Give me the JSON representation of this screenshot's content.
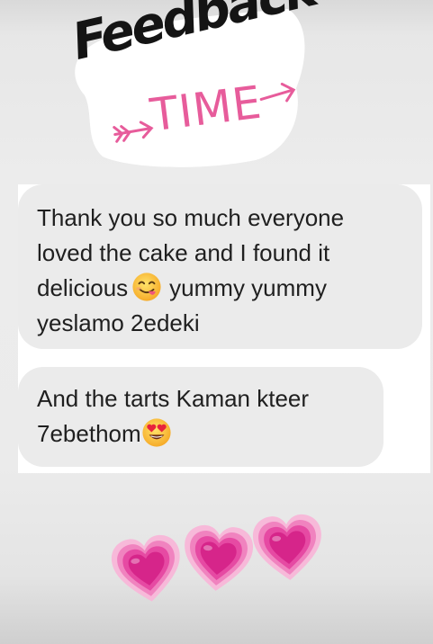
{
  "sticker": {
    "word": "Feedback",
    "sub": "TIME",
    "colors": {
      "ink": "#141414",
      "pink": "#e75c9b",
      "backing": "#ffffff"
    }
  },
  "messages": [
    {
      "lines": [
        "Thank you so much everyone",
        "loved the cake and I found it",
        "delicious",
        "yummy yummy",
        "yeslamo 2edeki"
      ],
      "emoji": "savoring-food-emoji"
    },
    {
      "lines": [
        "And the tarts Kaman kteer",
        "7ebethom"
      ],
      "emoji": "heart-eyes-emoji"
    }
  ],
  "decorations": {
    "hearts": [
      "growing-heart-icon",
      "growing-heart-icon",
      "growing-heart-icon"
    ],
    "heart_color": "#e4399a"
  }
}
